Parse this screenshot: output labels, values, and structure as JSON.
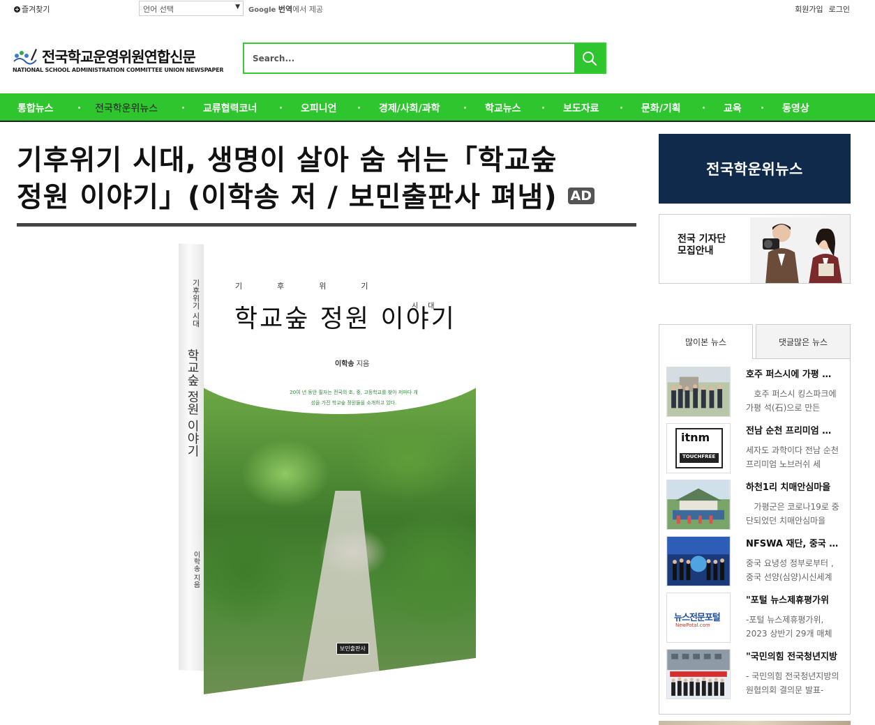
{
  "topbar": {
    "bookmark": "즐겨찾기",
    "language_select": "언어 선택",
    "google_brand": "Google",
    "translate_word": "번역",
    "translate_suffix": "에서 제공",
    "signup": "회원가입",
    "login": "로그인"
  },
  "header": {
    "logo_title": "전국학교운영위원연합신문",
    "logo_subtitle": "NATIONAL SCHOOL ADMINISTRATION COMMITTEE UNION NEWSPAPER",
    "search_placeholder": "Search...",
    "accent_color": "#2fc52f"
  },
  "nav": {
    "items": [
      "통합뉴스",
      "전국학운위뉴스",
      "교류협력코너",
      "오피니언",
      "경제/사회/과학",
      "학교뉴스",
      "보도자료",
      "문화/기획",
      "교육",
      "동영상"
    ]
  },
  "article": {
    "headline_line1": "기후위기 시대, 생명이 살아 숨 쉬는「학교숲",
    "headline_line2": "정원 이야기」(이학송 저 / 보민출판사 펴냄)",
    "ad_badge": "AD"
  },
  "book": {
    "series": "기후위기",
    "series_end": "시대",
    "title": "학교숲 정원 이야기",
    "author": "이학송",
    "author_suffix": "지음",
    "blurb": "20여 년 동안 필자는 전국의 초, 중, 고등학교를 찾아 저마다 개성을 가진 학교숲 정원들을 소개하고 있다.",
    "spine_series": "기후위기 시대",
    "spine_title": "학교숲 정원 이야기",
    "spine_author": "이학송 지음",
    "publisher": "보민출판사"
  },
  "sidebar": {
    "banner": "전국학운위뉴스",
    "recruit_line1": "전국 기자단",
    "recruit_line2": "모집안내",
    "tab_popular": "많이본 뉴스",
    "tab_comments": "댓글많은 뉴스",
    "news": [
      {
        "title": "호주 퍼스시에 가평 석(石)으로 만든",
        "desc": "호주 퍼스시 킹스파크에 가평 석(石)으로 만든"
      },
      {
        "title": "전남 순천 프리미엄 노브러쉬",
        "desc": "세자도 과학이다 전남 순천 프리미엄 노브러쉬 세"
      },
      {
        "title": "하천1리 치매안심마을",
        "desc": "가평군은 코로나19로 중단되었던 치매안심마을"
      },
      {
        "title": "NFSWA 재단, 중국 요녕성",
        "desc": "중국 요녕성 정부로부터 , 중국 선양(심양)시신세계"
      },
      {
        "title": "\"포털 뉴스제휴평가위",
        "desc": "-포털 뉴스제휴평가위, 2023 상반기 29개 매체"
      },
      {
        "title": "\"국민의힘 전국청년지방",
        "desc": "- 국민의힘 전국청년지방의원협의회 결의문 발표-"
      }
    ],
    "thumb_itnm_logo": "itnm",
    "thumb_itnm_label": "TOUCHFREE",
    "thumb_portal_logo": "뉴스전문포털",
    "thumb_portal_sub": "NewPotal.com"
  }
}
